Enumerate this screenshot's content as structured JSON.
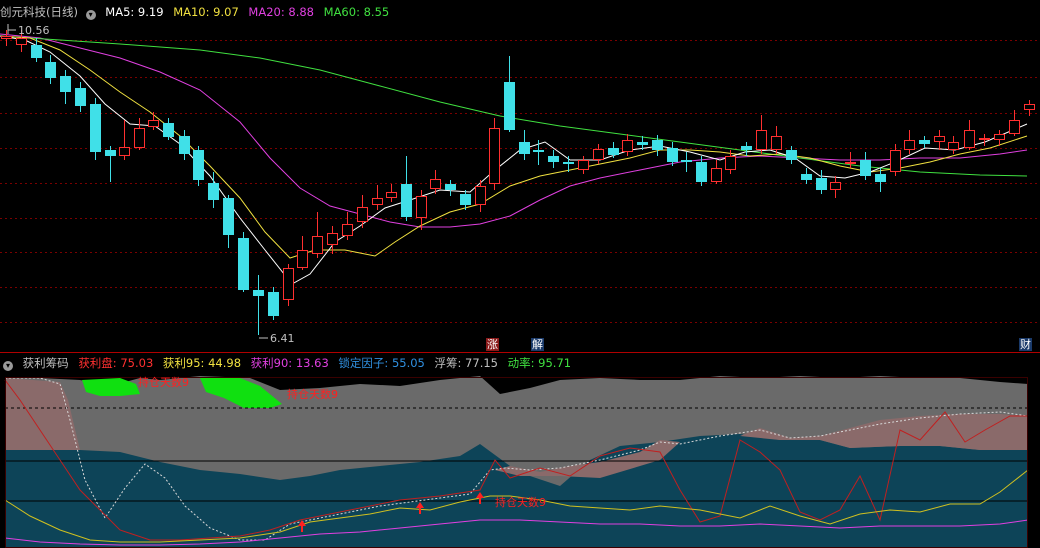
{
  "main": {
    "title": "创元科技(日线)",
    "ma_labels": [
      {
        "text": "MA5: 9.19",
        "color": "#ffffff"
      },
      {
        "text": "MA10: 9.07",
        "color": "#f0e040"
      },
      {
        "text": "MA20: 8.88",
        "color": "#e040e0"
      },
      {
        "text": "MA60: 8.55",
        "color": "#40e040"
      }
    ],
    "high_label": "10.56",
    "low_label": "6.41",
    "markers": {
      "zhang": "涨",
      "jie": "解",
      "cai": "财"
    }
  },
  "sub": {
    "title": "获利筹码",
    "stats": [
      {
        "text": "获利盘: 75.03",
        "color": "#ff3030"
      },
      {
        "text": "获利95: 44.98",
        "color": "#f0e040"
      },
      {
        "text": "获利90: 13.63",
        "color": "#e040e0"
      },
      {
        "text": "锁定因子: 55.05",
        "color": "#3090e0"
      },
      {
        "text": "浮筹: 77.15",
        "color": "#c0c0c0"
      },
      {
        "text": "动率: 95.71",
        "color": "#40e040"
      }
    ],
    "annotations": [
      "持仓天数9",
      "持仓天数9",
      "持仓天数9"
    ]
  },
  "colors": {
    "up": "#ff3030",
    "down": "#40e0e8",
    "grid": "#8b0000"
  }
}
